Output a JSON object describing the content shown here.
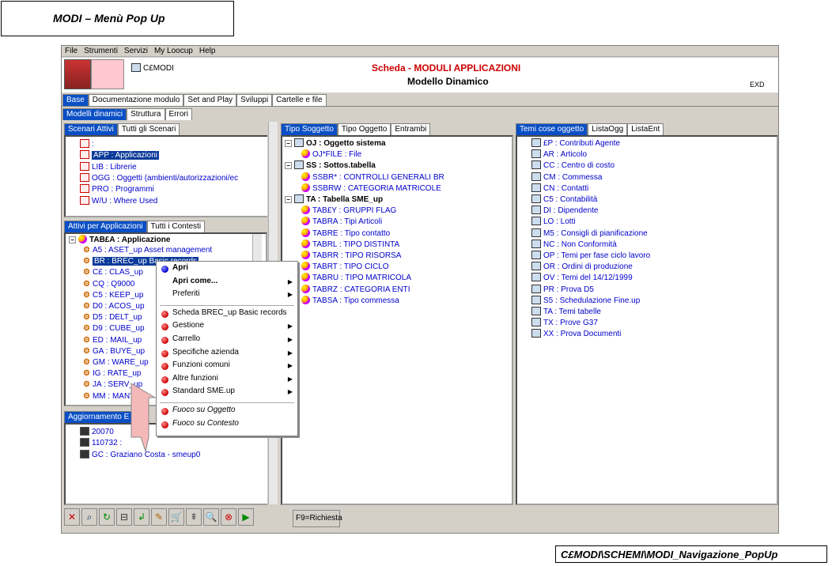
{
  "caption": {
    "title": "MODI – Menù Pop Up",
    "footer": "C£MODI\\SCHEMI\\MODI_Navigazione_PopUp"
  },
  "menubar": [
    "File",
    "Strumenti",
    "Servizi",
    "My Loocup",
    "Help"
  ],
  "header": {
    "object_code": "C£MODI",
    "title": "Scheda - MODULI APPLICAZIONI",
    "subtitle": "Modello Dinamico",
    "corner": "EXD"
  },
  "main_tabs": [
    "Base",
    "Documentazione modulo",
    "Set and Play",
    "Sviluppi",
    "Cartelle e file"
  ],
  "sub_tabs": [
    "Modelli dinamici",
    "Struttura",
    "Errori"
  ],
  "left_top": {
    "tabs": [
      "Scenari Attivi",
      "Tutti gli Scenari"
    ],
    "items": [
      {
        "code": ":",
        "label": ""
      },
      {
        "code": "APP",
        "label": ": Applicazioni"
      },
      {
        "code": "LIB",
        "label": ": Librerie"
      },
      {
        "code": "OGG",
        "label": ": Oggetti (ambienti/autorizzazioni/ec"
      },
      {
        "code": "PRO",
        "label": ": Programmi"
      },
      {
        "code": "W/U",
        "label": ": Where Used"
      }
    ]
  },
  "left_mid": {
    "tabs": [
      "Attivi per Applicazioni",
      "Tutti i Contesti"
    ],
    "root": "TAB£A  : Applicazione",
    "items": [
      {
        "code": "A5",
        "label": ": ASET_up Asset management"
      },
      {
        "code": "BR",
        "label": ": BREC_up Basic records"
      },
      {
        "code": "C£",
        "label": ": CLAS_up"
      },
      {
        "code": "CQ",
        "label": ": Q9000"
      },
      {
        "code": "C5",
        "label": ": KEEP_up"
      },
      {
        "code": "D0",
        "label": ": ACOS_up"
      },
      {
        "code": "D5",
        "label": ": DELT_up"
      },
      {
        "code": "D9",
        "label": ": CUBE_up"
      },
      {
        "code": "ED",
        "label": ": MAIL_up"
      },
      {
        "code": "GA",
        "label": ": BUYE_up"
      },
      {
        "code": "GM",
        "label": ": WARE_up"
      },
      {
        "code": "IG",
        "label": ": RATE_up"
      },
      {
        "code": "JA",
        "label": ": SERV_up"
      },
      {
        "code": "MM",
        "label": ": MANT_up"
      }
    ]
  },
  "left_bot": {
    "tab": "Aggiornamento E",
    "items": [
      "20070",
      "110732 :",
      "GC : Graziano Costa - smeup0"
    ]
  },
  "mid": {
    "tabs": [
      "Tipo Soggetto",
      "Tipo Oggetto",
      "Entrambi"
    ],
    "groups": [
      {
        "head": "OJ  : Oggetto sistema",
        "items": [
          "OJ*FILE : File"
        ]
      },
      {
        "head": "SS  : Sottos.tabella",
        "items": [
          "SSBR* : CONTROLLI GENERALI BR",
          "SSBRW : CATEGORIA MATRICOLE"
        ]
      },
      {
        "head": "TA  : Tabella SME_up",
        "items": [
          "TAB£Y : GRUPPI FLAG",
          "TABRA : Tipi Articoli",
          "TABRE : Tipo contatto",
          "TABRL : TIPO DISTINTA",
          "TABRR : TIPO RISORSA",
          "TABRT : TIPO CICLO",
          "TABRU : TIPO MATRICOLA",
          "TABRZ : CATEGORIA ENTI",
          "TABSA : Tipo commessa"
        ]
      }
    ]
  },
  "right": {
    "tabs": [
      "Temi cose oggetto",
      "ListaOgg",
      "ListaEnt"
    ],
    "items": [
      "£P : Contributi Agente",
      "AR : Articolo",
      "CC : Centro di costo",
      "CM : Commessa",
      "CN : Contatti",
      "C5 : Contabilità",
      "DI : Dipendente",
      "LO : Lotti",
      "M5 : Consigli di pianificazione",
      "NC : Non Conformità",
      "OP : Temi per fase ciclo lavoro",
      "OR : Ordini di produzione",
      "OV : Temi del 14/12/1999",
      "PR : Prova D5",
      "S5 : Schedulazione Fine.up",
      "TA : Temi tabelle",
      "TX : Prove G37",
      "XX : Prova Documenti"
    ]
  },
  "popup": {
    "items": [
      {
        "label": "Apri",
        "bold": true,
        "sub": false,
        "icon": "blue"
      },
      {
        "label": "Apri come...",
        "bold": true,
        "sub": true,
        "icon": ""
      },
      {
        "label": "Preferiti",
        "bold": false,
        "sub": true,
        "icon": ""
      },
      {
        "label": "Scheda BREC_up Basic records",
        "bold": false,
        "sub": false,
        "icon": "red"
      },
      {
        "label": "Gestione",
        "bold": false,
        "sub": true,
        "icon": "red"
      },
      {
        "label": "Carrello",
        "bold": false,
        "sub": true,
        "icon": "red"
      },
      {
        "label": "Specifiche azienda",
        "bold": false,
        "sub": true,
        "icon": "red"
      },
      {
        "label": "Funzioni comuni",
        "bold": false,
        "sub": true,
        "icon": "red"
      },
      {
        "label": "Altre funzioni",
        "bold": false,
        "sub": true,
        "icon": "red"
      },
      {
        "label": "Standard SME.up",
        "bold": false,
        "sub": true,
        "icon": "red"
      },
      {
        "label": "Fuoco su Oggetto",
        "bold": false,
        "sub": false,
        "icon": "red",
        "italic": true
      },
      {
        "label": "Fuoco su Contesto",
        "bold": false,
        "sub": false,
        "icon": "red",
        "italic": true
      }
    ]
  },
  "toolbar": {
    "buttons": [
      "✕",
      "⌕",
      "↻",
      "⊟",
      "↲",
      "✎",
      "🛒",
      "⇞",
      "🔍",
      "⊗",
      "▶"
    ],
    "request": "F9=Richiesta"
  }
}
